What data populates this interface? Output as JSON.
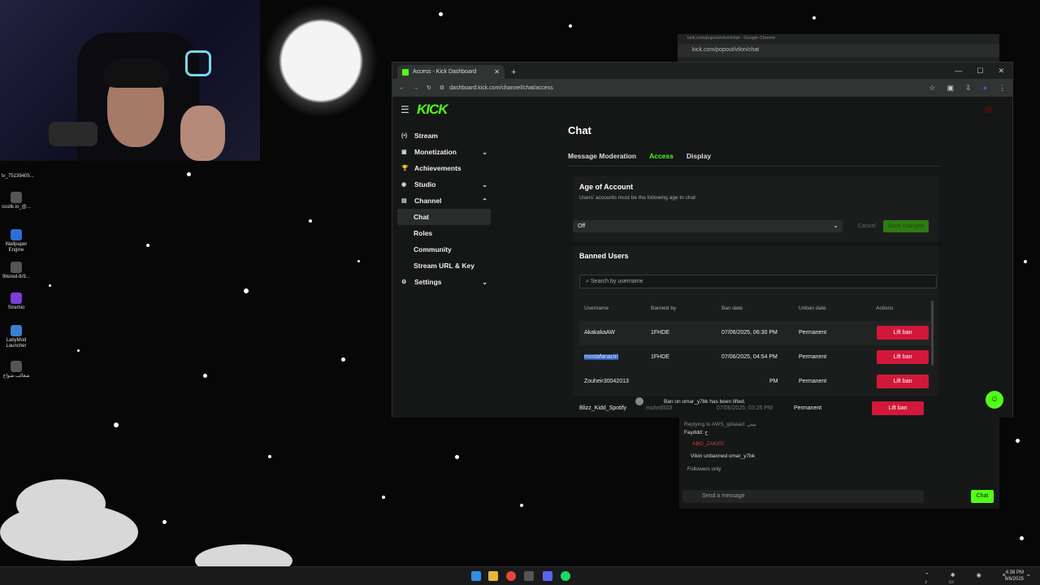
{
  "desktop": {
    "icons": [
      {
        "label": "tv_75139405..."
      },
      {
        "label": "ssstik.io_@..."
      },
      {
        "label": "Wallpaper Engine"
      },
      {
        "label": "filtered-8r9..."
      },
      {
        "label": "Stremio"
      },
      {
        "label": "LabyMod Launcher"
      },
      {
        "label": "شغالب شواخ"
      }
    ]
  },
  "popout": {
    "title": "kick.com/popout/vilon/chat - Google Chrome",
    "url": "kick.com/popout/vilon/chat"
  },
  "browser": {
    "tab_title": "Access - Kick Dashboard",
    "url": "dashboard.kick.com/channel/chat/access"
  },
  "kick": {
    "logo": "KICK",
    "sidebar": {
      "items": [
        {
          "label": "Stream",
          "icon": "(•)"
        },
        {
          "label": "Monetization",
          "icon": "▣"
        },
        {
          "label": "Achievements",
          "icon": "🏆"
        },
        {
          "label": "Studio",
          "icon": "◉"
        },
        {
          "label": "Channel",
          "icon": "▤"
        },
        {
          "label": "Chat"
        },
        {
          "label": "Roles"
        },
        {
          "label": "Community"
        },
        {
          "label": "Stream URL & Key"
        },
        {
          "label": "Settings",
          "icon": "⚙"
        }
      ]
    },
    "page_title": "Chat",
    "tabs": [
      "Message Moderation",
      "Access",
      "Display"
    ],
    "age": {
      "title": "Age of Account",
      "subtitle": "Users' accounts must be the following age to chat",
      "value": "Off",
      "cancel": "Cancel",
      "save": "Save changes"
    },
    "banned": {
      "title": "Banned Users",
      "search_placeholder": "Search by username",
      "columns": [
        "Username",
        "Banned by",
        "Ban date",
        "Unban date",
        "Actions"
      ],
      "rows": [
        {
          "user": "AkakakaAW",
          "by": "1FHDE",
          "date": "07/06/2025, 06:30 PM",
          "unban": "Permanent",
          "action": "Lift ban"
        },
        {
          "user": "mostafanaciri",
          "by": "1FHDE",
          "date": "07/06/2025, 04:54 PM",
          "unban": "Permanent",
          "action": "Lift ban"
        },
        {
          "user": "Zouheir30042013",
          "by": "",
          "date": "PM",
          "unban": "Permanent",
          "action": "Lift ban"
        },
        {
          "user": "Blizz_Kidd_Spotify",
          "by": "mohrdS03",
          "date": "07/06/2025, 03:25 PM",
          "unban": "Permanent",
          "action": "Lift ban"
        }
      ]
    },
    "toast": "Ban on omar_y7bk has been lifted."
  },
  "chat": {
    "reply": "Replying to AWS_gdaaad: بيبي",
    "line1": "Fayddd: ح",
    "line2_user": "ABO_ZAKI05",
    "system": "Vilon unbanned omar_y7bk",
    "followers": "Followers only",
    "placeholder": "Send a message",
    "button": "Chat"
  },
  "taskbar": {
    "time": "4:38 PM",
    "date": "9/6/2025"
  },
  "colors": {
    "accent": "#53fc18",
    "danger": "#d1183a"
  }
}
